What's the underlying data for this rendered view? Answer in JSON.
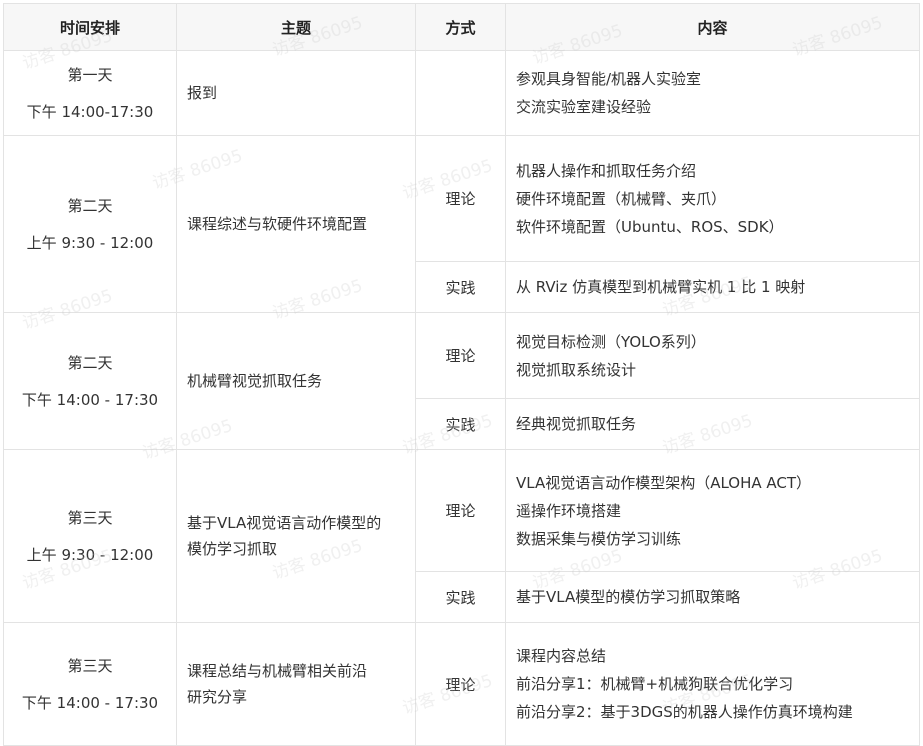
{
  "headers": {
    "time": "时间安排",
    "topic": "主题",
    "method": "方式",
    "content": "内容"
  },
  "rows": [
    {
      "day": "第一天",
      "slot": "下午 14:00-17:30",
      "topic": [
        "报到"
      ],
      "parts": [
        {
          "method": "",
          "items": [
            "参观具身智能/机器人实验室",
            "交流实验室建设经验"
          ]
        }
      ]
    },
    {
      "day": "第二天",
      "slot": "上午 9:30 - 12:00",
      "topic": [
        "课程综述与软硬件环境配置"
      ],
      "parts": [
        {
          "method": "理论",
          "items": [
            "机器人操作和抓取任务介绍",
            "硬件环境配置（机械臂、夹爪）",
            "软件环境配置（Ubuntu、ROS、SDK）"
          ]
        },
        {
          "method": "实践",
          "items": [
            "从 RViz 仿真模型到机械臂实机 1 比 1 映射"
          ]
        }
      ]
    },
    {
      "day": "第二天",
      "slot": "下午 14:00 - 17:30",
      "topic": [
        "机械臂视觉抓取任务"
      ],
      "parts": [
        {
          "method": "理论",
          "items": [
            "视觉目标检测（YOLO系列）",
            "视觉抓取系统设计"
          ]
        },
        {
          "method": "实践",
          "items": [
            "经典视觉抓取任务"
          ]
        }
      ]
    },
    {
      "day": "第三天",
      "slot": "上午 9:30 - 12:00",
      "topic": [
        "基于VLA视觉语言动作模型的",
        "模仿学习抓取"
      ],
      "parts": [
        {
          "method": "理论",
          "items": [
            "VLA视觉语言动作模型架构（ALOHA ACT）",
            "遥操作环境搭建",
            "数据采集与模仿学习训练"
          ]
        },
        {
          "method": "实践",
          "items": [
            "基于VLA模型的模仿学习抓取策略"
          ]
        }
      ]
    },
    {
      "day": "第三天",
      "slot": "下午 14:00 - 17:30",
      "topic": [
        "课程总结与机械臂相关前沿",
        "研究分享"
      ],
      "parts": [
        {
          "method": "理论",
          "items": [
            "课程内容总结",
            "前沿分享1：机械臂+机械狗联合优化学习",
            "前沿分享2：基于3DGS的机器人操作仿真环境构建"
          ]
        }
      ]
    }
  ],
  "watermark": "访客 86095"
}
